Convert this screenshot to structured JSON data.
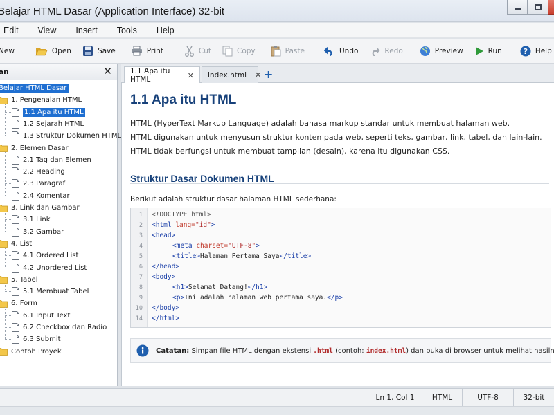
{
  "window": {
    "title": "Belajar HTML Dasar (Application Interface) 32-bit"
  },
  "menu": [
    "Edit",
    "View",
    "Insert",
    "Tools",
    "Help"
  ],
  "toolbar": {
    "new": "New",
    "open": "Open",
    "save": "Save",
    "print": "Print",
    "cut": "Cut",
    "copy": "Copy",
    "paste": "Paste",
    "undo": "Undo",
    "redo": "Redo",
    "preview": "Preview",
    "run": "Run",
    "help": "Help"
  },
  "sidebar": {
    "title": "an",
    "root": "Belajar HTML Dasar",
    "sections": [
      {
        "label": "1. Pengenalan HTML",
        "items": [
          "1.1 Apa itu HTML",
          "1.2 Sejarah HTML",
          "1.3 Struktur Dokumen HTML"
        ]
      },
      {
        "label": "2. Elemen Dasar",
        "items": [
          "2.1 Tag dan Elemen",
          "2.2 Heading",
          "2.3 Paragraf",
          "2.4 Komentar"
        ]
      },
      {
        "label": "3. Link dan Gambar",
        "items": [
          "3.1 Link",
          "3.2 Gambar"
        ]
      },
      {
        "label": "4. List",
        "items": [
          "4.1 Ordered List",
          "4.2 Unordered List"
        ]
      },
      {
        "label": "5. Tabel",
        "items": [
          "5.1 Membuat Tabel"
        ]
      },
      {
        "label": "6. Form",
        "items": [
          "6.1 Input Text",
          "6.2 Checkbox dan Radio",
          "6.3 Submit"
        ]
      },
      {
        "label": "Contoh Proyek",
        "items": []
      }
    ]
  },
  "tabs": [
    {
      "label": "1.1 Apa itu HTML",
      "close": "✕"
    },
    {
      "label": "index.html",
      "close": "✕"
    }
  ],
  "tab_add": "+",
  "content": {
    "title": "1.1 Apa itu HTML",
    "paragraphs": [
      "HTML (HyperText Markup Language) adalah bahasa markup standar untuk membuat halaman web.",
      "HTML digunakan untuk menyusun struktur konten pada web, seperti teks, gambar, link, tabel, dan lain-lain.",
      "HTML tidak berfungsi untuk membuat tampilan (desain), karena itu digunakan CSS."
    ],
    "subtitle": "Struktur Dasar Dokumen HTML",
    "intro": "Berikut adalah struktur dasar halaman HTML sederhana:",
    "code_line_numbers": [
      "1",
      "2",
      "3",
      "4",
      "5",
      "6",
      "7",
      "8",
      "9",
      "10",
      "14"
    ],
    "code": {
      "l1": "<!DOCTYPE html>",
      "l2a": "<html ",
      "l2b": "lang=",
      "l2c": "\"id\"",
      "l2d": ">",
      "l3": "<head>",
      "l4a": "<meta ",
      "l4b": "charset=",
      "l4c": "\"UTF-8\"",
      "l4d": ">",
      "l5a": "<title>",
      "l5b": "Halaman Pertama Saya",
      "l5c": "</title>",
      "l6": "</head>",
      "l7": "<body>",
      "l8a": "<h1>",
      "l8b": "Selamat Datang!",
      "l8c": "</h1>",
      "l9a": "<p>",
      "l9b": "Ini adalah halaman web pertama saya.",
      "l9c": "</p>",
      "l10": "</body>",
      "l11": "</html>"
    },
    "note": {
      "label": "Catatan:",
      "text1": " Simpan file HTML dengan ekstensi ",
      "ext": ".html",
      "text2": " (contoh: ",
      "example": "index.html",
      "text3": ") dan buka di browser untuk melihat hasilnya."
    }
  },
  "status": {
    "position": "Ln 1, Col 1",
    "language": "HTML",
    "encoding": "UTF-8",
    "arch": "32-bit"
  },
  "colors": {
    "accent": "#1f6fd1",
    "heading": "#17417a",
    "tag": "#1a3fa8",
    "attr": "#c0392b"
  }
}
